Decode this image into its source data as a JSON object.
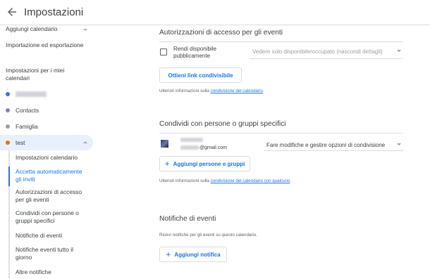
{
  "header": {
    "title": "Impostazioni"
  },
  "sidebar": {
    "add_calendar": "Aggiungi calendario",
    "import_export": "Importazione ed esportazione",
    "my_calendars_heading": "Impostazioni per i miei calendari",
    "calendars": [
      {
        "label": "",
        "color": "#3f6fd8",
        "blurred": true
      },
      {
        "label": "Contacts",
        "color": "#7986cb"
      },
      {
        "label": "Famiglia",
        "color": "#a79b8e"
      },
      {
        "label": "test",
        "color": "#ef6c00",
        "selected": true
      }
    ],
    "submenu": [
      {
        "label": "Impostazioni calendario"
      },
      {
        "label": "Accetta automaticamente gli inviti",
        "active": true
      },
      {
        "label": "Autorizzazioni di accesso per gli eventi"
      },
      {
        "label": "Condividi con persone o gruppi specifici"
      },
      {
        "label": "Notifiche di eventi"
      },
      {
        "label": "Notifiche eventi tutto il giorno"
      },
      {
        "label": "Altre notifiche"
      }
    ]
  },
  "access": {
    "title": "Autorizzazioni di accesso per gli eventi",
    "checkbox_label": "Rendi disponibile pubblicamente",
    "visibility_select": "Vedere solo disponibile/occupato (nascondi dettagli)",
    "link_button": "Ottieni link condivisibile",
    "info_text": "Ulteriori informazioni sulla ",
    "info_link": "condivisione del calendario"
  },
  "share": {
    "title": "Condividi con persone o gruppi specifici",
    "person_email_suffix": "@gmail.com",
    "permission_select": "Fare modifiche e gestire opzioni di condivisione",
    "add_button": "Aggiungi persone e gruppi",
    "info_text": "Ulteriori informazioni sulla ",
    "info_link": "condivisione del calendario con qualcuno"
  },
  "notifications": {
    "title": "Notifiche di eventi",
    "description": "Ricevi notifiche per gli eventi su questo calendario.",
    "add_button": "Aggiungi notifica"
  },
  "colors": {
    "accent": "#1a73e8",
    "selected_bg": "#e8f0fe",
    "divider": "#dadce0"
  }
}
